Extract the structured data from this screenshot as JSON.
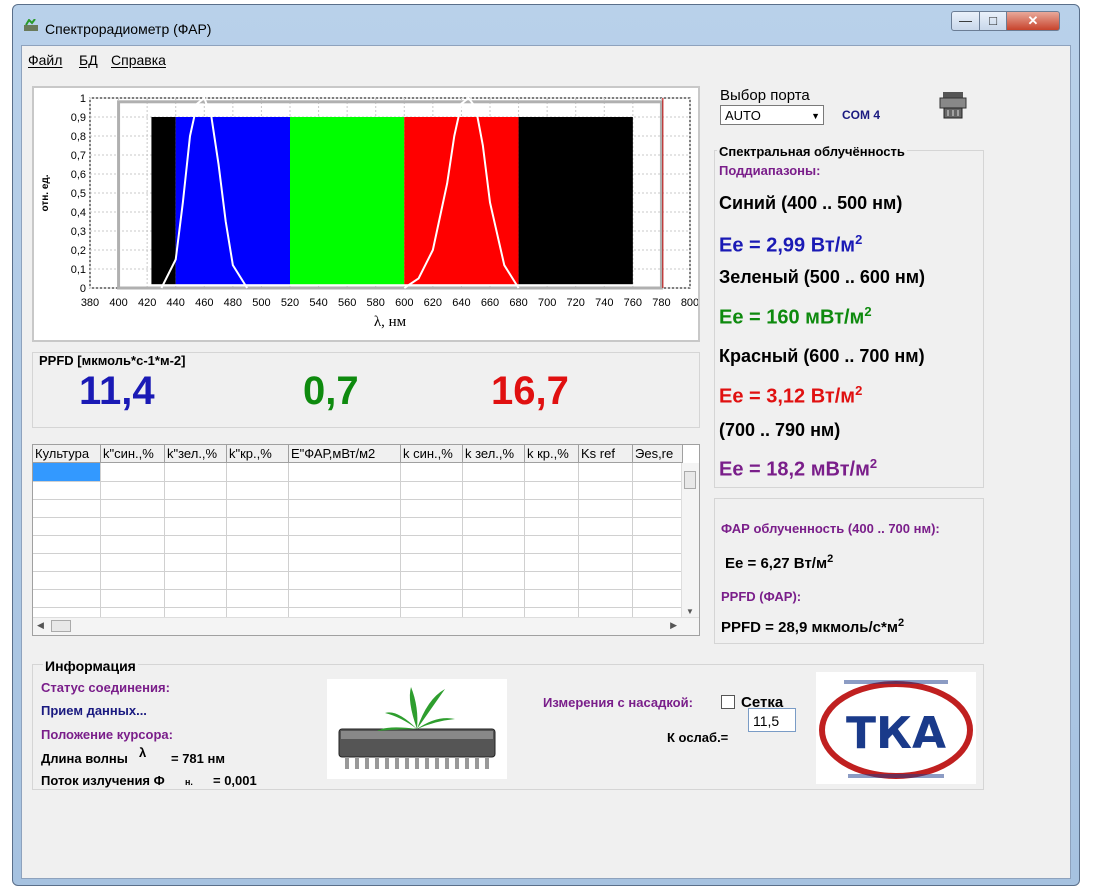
{
  "window": {
    "title": "Спектрорадиометр (ФАР)",
    "min": "—",
    "max": "□",
    "close": "✕"
  },
  "menu": {
    "items": [
      "Файл",
      "БД",
      "Справка"
    ]
  },
  "chart_data": {
    "type": "line",
    "ylabel": "отн. ед.",
    "xlabel": "λ, нм",
    "xlim": [
      380,
      800
    ],
    "ylim": [
      0,
      1
    ],
    "x_ticks": [
      380,
      400,
      420,
      440,
      460,
      480,
      500,
      520,
      540,
      560,
      580,
      600,
      620,
      640,
      660,
      680,
      700,
      720,
      740,
      760,
      780,
      800
    ],
    "y_ticks": [
      "0",
      "0,1",
      "0,2",
      "0,3",
      "0,4",
      "0,5",
      "0,6",
      "0,7",
      "0,8",
      "0,9",
      "1"
    ],
    "bands": [
      {
        "from": 423,
        "to": 440,
        "color": "#000000",
        "height": 0.9
      },
      {
        "from": 440,
        "to": 520,
        "color": "#0000ff",
        "height": 0.9
      },
      {
        "from": 520,
        "to": 600,
        "color": "#00ff00",
        "height": 0.9
      },
      {
        "from": 600,
        "to": 680,
        "color": "#ff0000",
        "height": 0.9
      },
      {
        "from": 680,
        "to": 760,
        "color": "#000000",
        "height": 0.9
      }
    ],
    "series": [
      {
        "color": "#ffffff",
        "x": [
          430,
          440,
          445,
          450,
          455,
          460,
          465,
          470,
          475,
          480,
          490
        ],
        "y": [
          0.0,
          0.15,
          0.45,
          0.8,
          0.97,
          1.0,
          0.9,
          0.65,
          0.35,
          0.12,
          0.0
        ]
      },
      {
        "color": "#ffffff",
        "x": [
          600,
          610,
          620,
          630,
          635,
          640,
          645,
          650,
          655,
          660,
          670,
          680
        ],
        "y": [
          0.0,
          0.05,
          0.2,
          0.55,
          0.8,
          0.97,
          1.0,
          0.95,
          0.75,
          0.45,
          0.12,
          0.0
        ]
      }
    ],
    "plot_area_line": {
      "x": 0.95,
      "color": "#c0c0c0"
    },
    "cursor_line": {
      "x": 781,
      "color": "#c00000"
    }
  },
  "ppfd": {
    "title": "PPFD [мкмоль*с-1*м-2]",
    "blue": "11,4",
    "green": "0,7",
    "red": "16,7",
    "colors": {
      "blue": "#1a1ab5",
      "green": "#0e8a0e",
      "red": "#e01010"
    }
  },
  "table": {
    "columns": [
      "Культура",
      "k\"син.,%",
      "k\"зел.,%",
      "k\"кр.,%",
      "E\"ФАР,мВт/м2",
      "k син.,%",
      "k зел.,%",
      "k кр.,%",
      "Ks ref",
      "Эes,re"
    ]
  },
  "port": {
    "label": "Выбор порта",
    "value": "AUTO",
    "com": "COM 4"
  },
  "spectral": {
    "title": "Спектральная облучённость",
    "subranges_label": "Поддиапазоны:",
    "blue_range": "Синий (400 .. 500 нм)",
    "blue_value": "Ee = 2,99 Вт/м",
    "green_range": "Зеленый (500 .. 600 нм)",
    "green_value": "Ee = 160 мВт/м",
    "red_range": "Красный (600 .. 700 нм)",
    "red_value": "Ee = 3,12 Вт/м",
    "far_range": "(700 .. 790 нм)",
    "far_value": "Ee = 18,2 мВт/м",
    "sup": "2",
    "colors": {
      "blue": "#1a1ab5",
      "green": "#0e8a0e",
      "red": "#e01010",
      "purple": "#7a1e8a"
    }
  },
  "par": {
    "title": "ФАР облученность (400 .. 700 нм):",
    "value": "Ee = 6,27 Вт/м",
    "ppfd_label": "PPFD (ФАР):",
    "ppfd_value": "PPFD = 28,9 мкмоль/с*м",
    "sup": "2"
  },
  "info": {
    "title": "Информация",
    "status_label": "Статус соединения:",
    "status_value": "Прием данных...",
    "cursor_label": "Положение курсора:",
    "wavelength_label": "Длина волны",
    "lambda": "λ",
    "wavelength_value": "= 781 нм",
    "flux_label": "Поток излучения Ф",
    "flux_sub": "н.",
    "flux_value": "= 0,001"
  },
  "nozzle": {
    "label": "Измерения с насадкой:",
    "checkbox_label": "Сетка",
    "checked": false,
    "atten_label": "К ослаб.=",
    "atten_value": "11,5"
  },
  "logo": {
    "text": "ТКА"
  }
}
